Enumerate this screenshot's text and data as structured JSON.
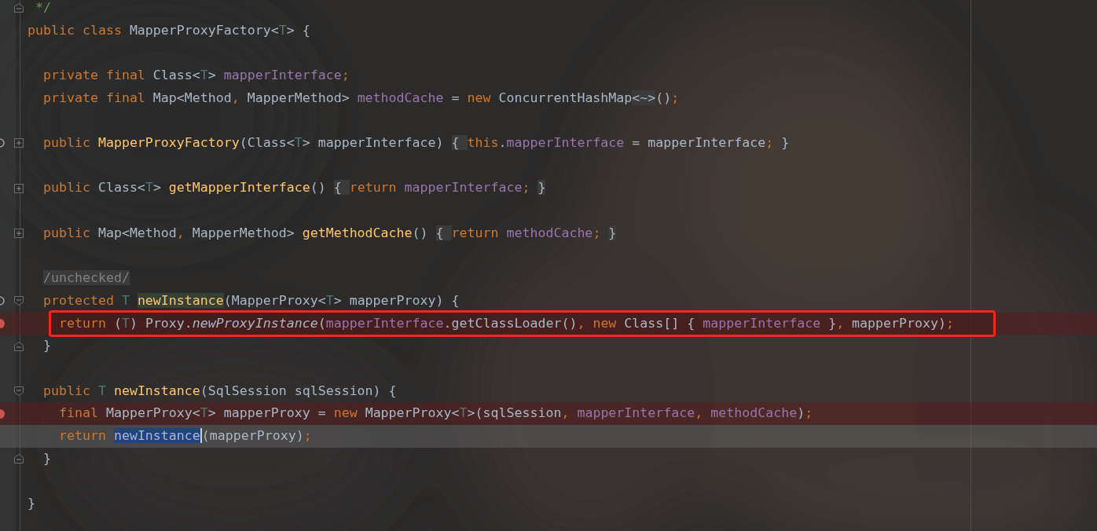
{
  "editor": {
    "lines": [
      {
        "fold": {
          "kind": "close"
        },
        "breakpoint": false,
        "current": false,
        "boxed": false,
        "tokens": [
          {
            "text": " */",
            "kind": "comment"
          }
        ]
      },
      {
        "breakpoint": false,
        "current": false,
        "boxed": false,
        "tokens": [
          {
            "text": "public class ",
            "kind": "keyword"
          },
          {
            "text": "MapperProxyFactory<",
            "kind": "plain"
          },
          {
            "text": "T",
            "kind": "type_param"
          },
          {
            "text": "> {",
            "kind": "plain"
          }
        ]
      },
      {
        "breakpoint": false,
        "current": false,
        "boxed": false
      },
      {
        "breakpoint": false,
        "current": false,
        "boxed": false,
        "tokens": [
          {
            "text": "  private final ",
            "kind": "keyword"
          },
          {
            "text": "Class<",
            "kind": "plain"
          },
          {
            "text": "T",
            "kind": "type_param"
          },
          {
            "text": "> ",
            "kind": "plain"
          },
          {
            "text": "mapperInterface",
            "kind": "field"
          },
          {
            "text": ";",
            "kind": "keyword"
          }
        ]
      },
      {
        "breakpoint": false,
        "current": false,
        "boxed": false,
        "tokens": [
          {
            "text": "  private final ",
            "kind": "keyword"
          },
          {
            "text": "Map<Method",
            "kind": "plain"
          },
          {
            "text": ", ",
            "kind": "keyword"
          },
          {
            "text": "MapperMethod> ",
            "kind": "plain"
          },
          {
            "text": "methodCache",
            "kind": "field"
          },
          {
            "text": " = ",
            "kind": "plain"
          },
          {
            "text": "new ",
            "kind": "keyword"
          },
          {
            "text": "ConcurrentHashMap",
            "kind": "plain"
          },
          {
            "text": "<~>",
            "kind": "fold_brace"
          },
          {
            "text": "()",
            "kind": "plain"
          },
          {
            "text": ";",
            "kind": "keyword"
          }
        ]
      },
      {
        "breakpoint": false,
        "current": false,
        "boxed": false
      },
      {
        "fold": {
          "kind": "collapsed"
        },
        "marker": {
          "kind": "implements"
        },
        "breakpoint": false,
        "current": false,
        "boxed": false,
        "tokens": [
          {
            "text": "  public ",
            "kind": "keyword"
          },
          {
            "text": "MapperProxyFactory",
            "kind": "method"
          },
          {
            "text": "(Class<",
            "kind": "plain"
          },
          {
            "text": "T",
            "kind": "type_param"
          },
          {
            "text": "> mapperInterface) ",
            "kind": "plain"
          },
          {
            "text": "{ ",
            "kind": "fold_brace"
          },
          {
            "text": "this",
            "kind": "keyword"
          },
          {
            "text": ".",
            "kind": "plain"
          },
          {
            "text": "mapperInterface",
            "kind": "field"
          },
          {
            "text": " = mapperInterface",
            "kind": "plain"
          },
          {
            "text": "; ",
            "kind": "keyword"
          },
          {
            "text": "}",
            "kind": "fold_brace"
          }
        ]
      },
      {
        "breakpoint": false,
        "current": false,
        "boxed": false
      },
      {
        "fold": {
          "kind": "collapsed"
        },
        "breakpoint": false,
        "current": false,
        "boxed": false,
        "tokens": [
          {
            "text": "  public ",
            "kind": "keyword"
          },
          {
            "text": "Class<",
            "kind": "plain"
          },
          {
            "text": "T",
            "kind": "type_param"
          },
          {
            "text": "> ",
            "kind": "plain"
          },
          {
            "text": "getMapperInterface",
            "kind": "method"
          },
          {
            "text": "() ",
            "kind": "plain"
          },
          {
            "text": "{ ",
            "kind": "fold_brace"
          },
          {
            "text": "return ",
            "kind": "keyword"
          },
          {
            "text": "mapperInterface",
            "kind": "field"
          },
          {
            "text": "; ",
            "kind": "keyword"
          },
          {
            "text": "}",
            "kind": "fold_brace"
          }
        ]
      },
      {
        "breakpoint": false,
        "current": false,
        "boxed": false
      },
      {
        "fold": {
          "kind": "collapsed"
        },
        "breakpoint": false,
        "current": false,
        "boxed": false,
        "tokens": [
          {
            "text": "  public ",
            "kind": "keyword"
          },
          {
            "text": "Map<Method",
            "kind": "plain"
          },
          {
            "text": ", ",
            "kind": "keyword"
          },
          {
            "text": "MapperMethod> ",
            "kind": "plain"
          },
          {
            "text": "getMethodCache",
            "kind": "method"
          },
          {
            "text": "() ",
            "kind": "plain"
          },
          {
            "text": "{ ",
            "kind": "fold_brace"
          },
          {
            "text": "return ",
            "kind": "keyword"
          },
          {
            "text": "methodCache",
            "kind": "field"
          },
          {
            "text": "; ",
            "kind": "keyword"
          },
          {
            "text": "}",
            "kind": "fold_brace"
          }
        ]
      },
      {
        "breakpoint": false,
        "current": false,
        "boxed": false
      },
      {
        "breakpoint": false,
        "current": false,
        "boxed": false,
        "tokens": [
          {
            "text": "  /unchecked/",
            "kind": "folded_comment"
          }
        ]
      },
      {
        "fold": {
          "kind": "open"
        },
        "marker": {
          "kind": "implements"
        },
        "breakpoint": false,
        "current": false,
        "boxed": false,
        "tokens": [
          {
            "text": "  protected ",
            "kind": "keyword"
          },
          {
            "text": "T ",
            "kind": "type_param"
          },
          {
            "text": "newInstance",
            "kind": "method_usage"
          },
          {
            "text": "(MapperProxy<",
            "kind": "plain"
          },
          {
            "text": "T",
            "kind": "type_param"
          },
          {
            "text": "> mapperProxy) {",
            "kind": "plain"
          }
        ]
      },
      {
        "breakpoint": true,
        "current": false,
        "boxed": true,
        "tokens": [
          {
            "text": "    return ",
            "kind": "keyword"
          },
          {
            "text": "(",
            "kind": "plain"
          },
          {
            "text": "T",
            "kind": "type_param"
          },
          {
            "text": ") Proxy.",
            "kind": "plain"
          },
          {
            "text": "newProxyInstance",
            "kind": "static_call"
          },
          {
            "text": "(",
            "kind": "plain"
          },
          {
            "text": "mapperInterface",
            "kind": "field"
          },
          {
            "text": ".getClassLoader()",
            "kind": "plain"
          },
          {
            "text": ", ",
            "kind": "keyword"
          },
          {
            "text": "new ",
            "kind": "keyword"
          },
          {
            "text": "Class[] { ",
            "kind": "plain"
          },
          {
            "text": "mapperInterface ",
            "kind": "field"
          },
          {
            "text": "}",
            "kind": "plain"
          },
          {
            "text": ", ",
            "kind": "keyword"
          },
          {
            "text": "mapperProxy)",
            "kind": "plain"
          },
          {
            "text": ";",
            "kind": "keyword"
          }
        ]
      },
      {
        "fold": {
          "kind": "close"
        },
        "breakpoint": false,
        "current": false,
        "boxed": false,
        "tokens": [
          {
            "text": "  }",
            "kind": "plain"
          }
        ]
      },
      {
        "breakpoint": false,
        "current": false,
        "boxed": false
      },
      {
        "fold": {
          "kind": "open"
        },
        "breakpoint": false,
        "current": false,
        "boxed": false,
        "tokens": [
          {
            "text": "  public ",
            "kind": "keyword"
          },
          {
            "text": "T ",
            "kind": "type_param"
          },
          {
            "text": "newInstance",
            "kind": "method"
          },
          {
            "text": "(SqlSession sqlSession) {",
            "kind": "plain"
          }
        ]
      },
      {
        "breakpoint": true,
        "current": false,
        "boxed": false,
        "tokens": [
          {
            "text": "    final ",
            "kind": "keyword"
          },
          {
            "text": "MapperProxy<",
            "kind": "plain"
          },
          {
            "text": "T",
            "kind": "type_param"
          },
          {
            "text": "> mapperProxy = ",
            "kind": "plain"
          },
          {
            "text": "new ",
            "kind": "keyword"
          },
          {
            "text": "MapperProxy<",
            "kind": "plain"
          },
          {
            "text": "T",
            "kind": "type_param"
          },
          {
            "text": ">(sqlSession",
            "kind": "plain"
          },
          {
            "text": ", ",
            "kind": "keyword"
          },
          {
            "text": "mapperInterface",
            "kind": "field"
          },
          {
            "text": ", ",
            "kind": "keyword"
          },
          {
            "text": "methodCache",
            "kind": "field"
          },
          {
            "text": ")",
            "kind": "plain"
          },
          {
            "text": ";",
            "kind": "keyword"
          }
        ]
      },
      {
        "breakpoint": false,
        "current": true,
        "boxed": false,
        "tokens": [
          {
            "text": "    return ",
            "kind": "keyword"
          },
          {
            "text": "newInstance",
            "kind": "selected",
            "caret": true
          },
          {
            "text": "(mapperProxy)",
            "kind": "plain"
          },
          {
            "text": ";",
            "kind": "keyword"
          }
        ]
      },
      {
        "fold": {
          "kind": "close"
        },
        "breakpoint": false,
        "current": false,
        "boxed": false,
        "tokens": [
          {
            "text": "  }",
            "kind": "plain"
          }
        ]
      },
      {
        "breakpoint": false,
        "current": false,
        "boxed": false
      },
      {
        "breakpoint": false,
        "current": false,
        "boxed": false,
        "tokens": [
          {
            "text": "}",
            "kind": "plain"
          }
        ]
      }
    ]
  }
}
